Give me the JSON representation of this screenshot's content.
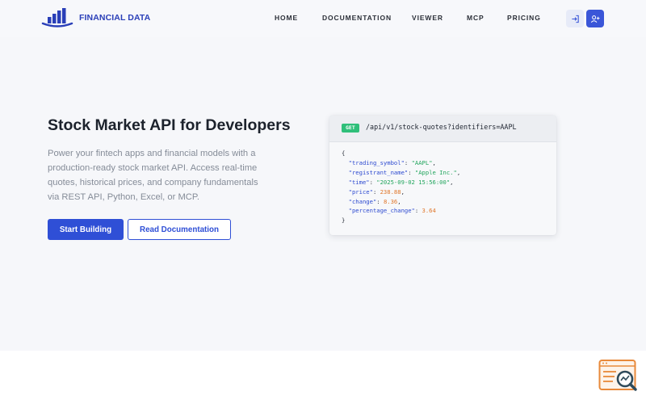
{
  "brand": {
    "name": "FINANCIAL DATA"
  },
  "nav": {
    "items": [
      "HOME",
      "DOCUMENTATION",
      "VIEWER",
      "MCP",
      "PRICING"
    ]
  },
  "header_icons": {
    "login": "login-icon",
    "signup": "user-plus-icon"
  },
  "hero": {
    "title": "Stock Market API for Developers",
    "description": "Power your fintech apps and financial models with a production-ready stock market API. Access real-time quotes, historical prices, and company fundamentals via REST API, Python, Excel, or MCP.",
    "primary_button": "Start Building",
    "secondary_button": "Read Documentation"
  },
  "code_example": {
    "method": "GET",
    "endpoint": "/api/v1/stock-quotes?identifiers=AAPL",
    "open_brace": "{",
    "close_brace": "}",
    "fields": [
      {
        "key": "\"trading_symbol\"",
        "value": "\"AAPL\"",
        "type": "string"
      },
      {
        "key": "\"registrant_name\"",
        "value": "\"Apple Inc.\"",
        "type": "string"
      },
      {
        "key": "\"time\"",
        "value": "\"2025-09-02 15:56:00\"",
        "type": "string"
      },
      {
        "key": "\"price\"",
        "value": "238.88",
        "type": "number"
      },
      {
        "key": "\"change\"",
        "value": "8.36",
        "type": "number"
      },
      {
        "key": "\"percentage_change\"",
        "value": "3.64",
        "type": "number"
      }
    ]
  },
  "colors": {
    "brand_blue": "#2a3fb8",
    "primary_button": "#2f4fd6",
    "get_badge": "#2fbf7a",
    "json_key": "#2d4ad0",
    "json_string": "#22a55d",
    "json_number": "#e0762a",
    "widget_orange": "#e8893a"
  },
  "floating_widget": {
    "icon": "search-chart-icon"
  }
}
